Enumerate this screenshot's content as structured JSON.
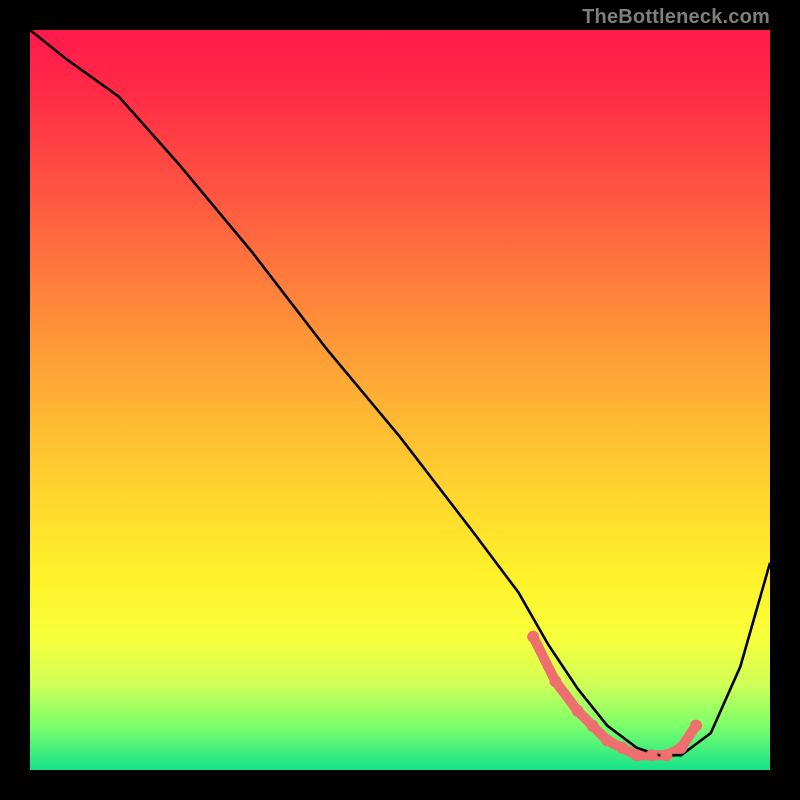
{
  "attribution": "TheBottleneck.com",
  "chart_data": {
    "type": "line",
    "title": "",
    "xlabel": "",
    "ylabel": "",
    "xlim": [
      0,
      100
    ],
    "ylim": [
      0,
      100
    ],
    "background_palette": {
      "top": "#ff1a4b",
      "mid_upper": "#ffb733",
      "mid": "#fff22a",
      "bottom": "#16e38a"
    },
    "series": [
      {
        "name": "bottleneck-curve",
        "color": "#000000",
        "x": [
          0,
          5,
          12,
          20,
          30,
          40,
          50,
          60,
          66,
          70,
          74,
          78,
          82,
          85,
          88,
          92,
          96,
          100
        ],
        "y": [
          100,
          96,
          91,
          82,
          70,
          57,
          45,
          32,
          24,
          17,
          11,
          6,
          3,
          2,
          2,
          5,
          14,
          28
        ]
      }
    ],
    "markers": {
      "name": "highlight-flat-region",
      "color": "#ef6e6e",
      "x": [
        68,
        71,
        74,
        76,
        78,
        80,
        82,
        84,
        86,
        88,
        90
      ],
      "y": [
        18,
        12,
        8,
        6,
        4,
        3,
        2,
        2,
        2,
        3,
        6
      ]
    }
  }
}
